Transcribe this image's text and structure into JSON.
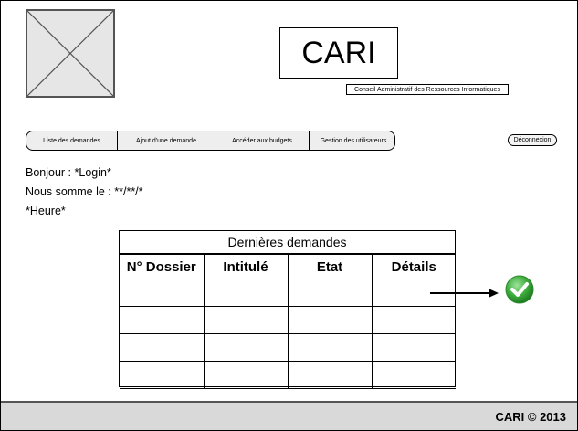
{
  "header": {
    "logo_placeholder_icon": "image-placeholder-icon",
    "app_title": "CARI",
    "app_subtitle": "Conseil Administratif des Ressources Informatiques"
  },
  "nav": {
    "items": [
      {
        "label": "Liste des demandes"
      },
      {
        "label": "Ajout d'une demande"
      },
      {
        "label": "Accéder aux budgets"
      },
      {
        "label": "Gestion des utilisateurs"
      }
    ],
    "logout_label": "Déconnexion"
  },
  "greeting": {
    "hello": "Bonjour : *Login*",
    "date": "Nous somme le : **/**/*",
    "time": "*Heure*"
  },
  "table": {
    "title": "Dernières demandes",
    "columns": [
      "N° Dossier",
      "Intitulé",
      "Etat",
      "Détails"
    ],
    "rows": [
      [
        "",
        "",
        "",
        ""
      ],
      [
        "",
        "",
        "",
        ""
      ],
      [
        "",
        "",
        "",
        ""
      ],
      [
        "",
        "",
        "",
        ""
      ]
    ]
  },
  "annotation": {
    "arrow_icon": "arrow-right-icon",
    "check_icon": "green-check-icon",
    "check_color": "#3cab3c"
  },
  "footer": {
    "text": "CARI © 2013"
  }
}
